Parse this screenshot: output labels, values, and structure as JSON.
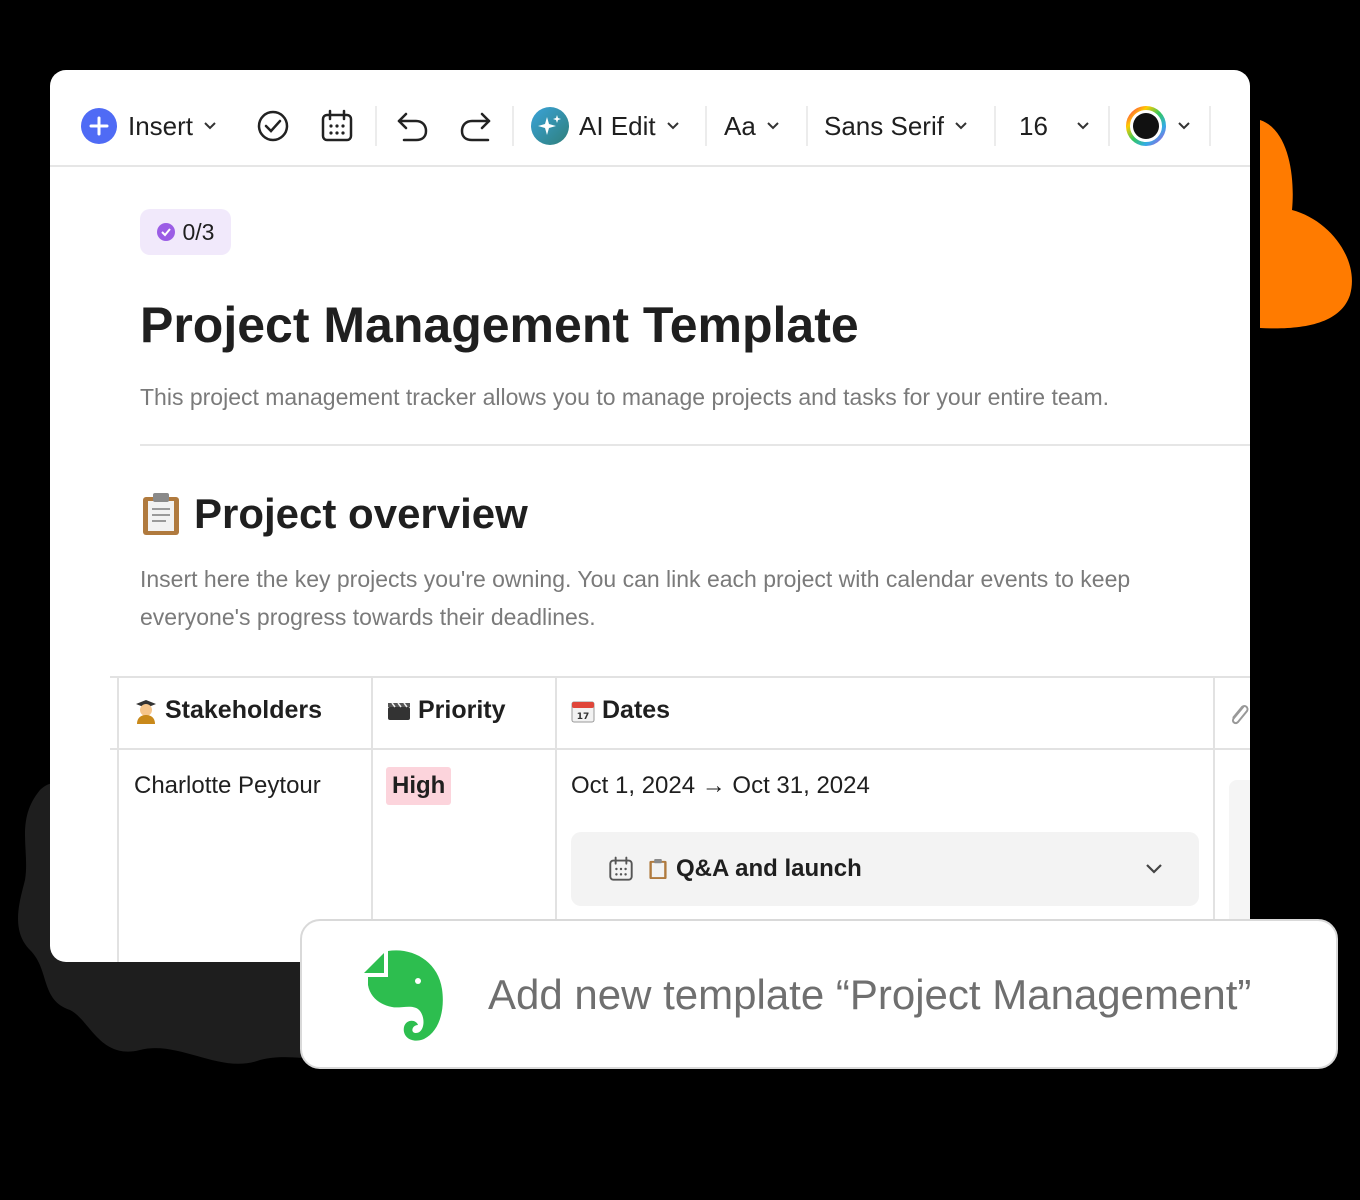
{
  "toolbar": {
    "insert_label": "Insert",
    "ai_edit_label": "AI Edit",
    "text_style_label": "Aa",
    "font_label": "Sans Serif",
    "font_size": "16",
    "accent_color": "#4f6bf5"
  },
  "doc": {
    "progress": "0/3",
    "title": "Project Management Template",
    "description": "This project management tracker allows you to manage projects and tasks for your entire team.",
    "section_title": "Project overview",
    "section_text": "Insert here the key projects you're owning. You can link each project with calendar events to keep everyone's progress towards their deadlines."
  },
  "table": {
    "headers": [
      "Stakeholders",
      "Priority",
      "Dates"
    ],
    "row": {
      "stakeholder": "Charlotte Peytour",
      "priority": "High",
      "dates": "Oct 1, 2024 → Oct 31, 2024",
      "event": "Q&A and launch"
    },
    "priority_color": "#fcd4dc"
  },
  "toast": {
    "text": "Add new template “Project Management”",
    "icon": "evernote-elephant-icon",
    "icon_color": "#2dbe4f"
  }
}
